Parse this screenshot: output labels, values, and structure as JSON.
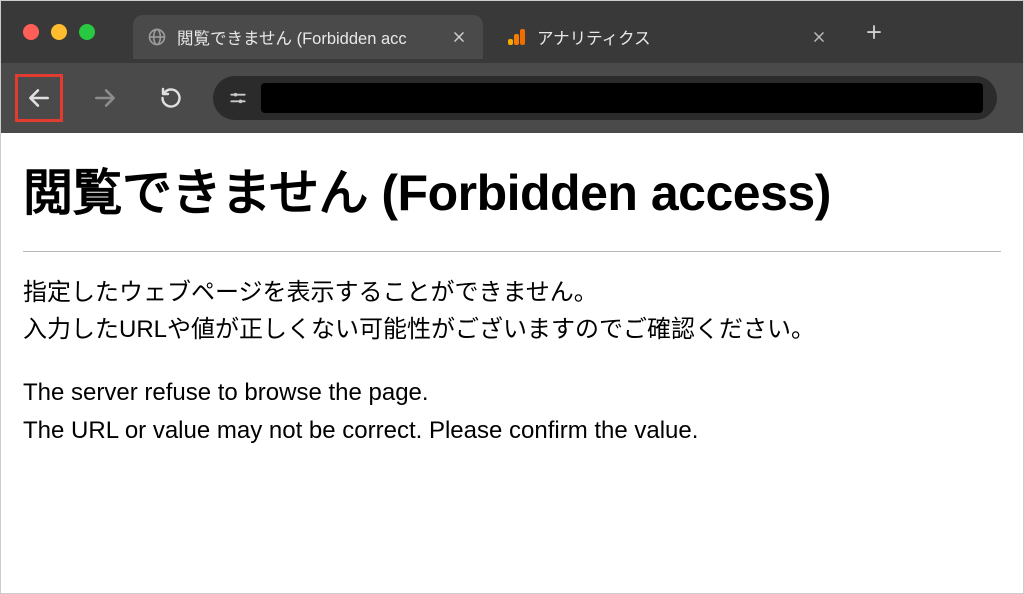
{
  "chrome": {
    "tabs": [
      {
        "title": "閲覧できません (Forbidden acc",
        "active": true
      },
      {
        "title": "アナリティクス",
        "active": false
      }
    ],
    "icons": {
      "globe": "globe-icon",
      "analytics": "google-analytics-icon",
      "back": "back-arrow-icon",
      "forward": "forward-arrow-icon",
      "reload": "reload-icon",
      "site": "site-settings-icon",
      "newtab": "plus-icon",
      "close": "close-icon"
    }
  },
  "page": {
    "heading": "閲覧できません (Forbidden access)",
    "jp_line1": "指定したウェブページを表示することができません。",
    "jp_line2": "入力したURLや値が正しくない可能性がございますのでご確認ください。",
    "en_line1": "The server refuse to browse the page.",
    "en_line2": "The URL or value may not be correct. Please confirm the value."
  }
}
